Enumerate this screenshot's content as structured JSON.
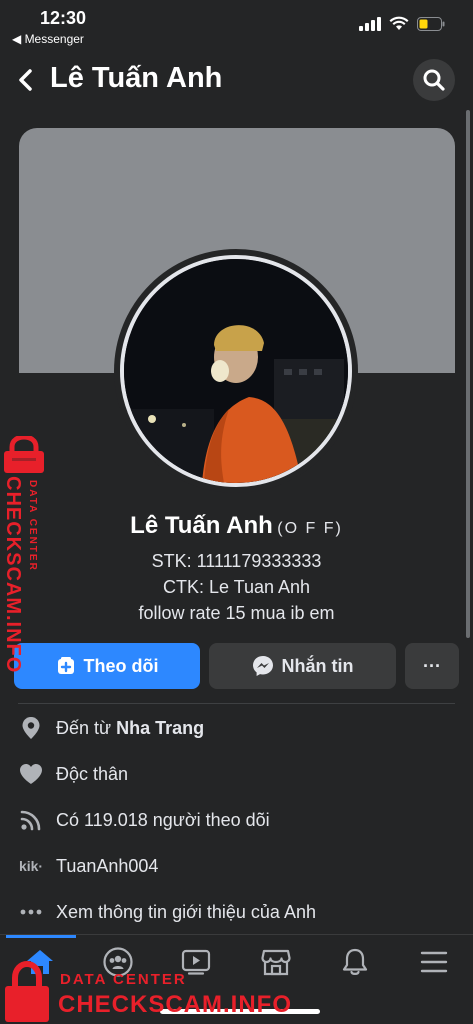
{
  "status_bar": {
    "time": "12:30",
    "back_app": "◀ Messenger"
  },
  "header": {
    "title": "Lê Tuấn Anh"
  },
  "profile": {
    "name": "Lê Tuấn Anh",
    "status": "(O F F)",
    "bio": [
      "STK: 1111179333333",
      "CTK: Le Tuan Anh",
      "follow rate 15 mua ib em"
    ]
  },
  "actions": {
    "follow_label": "Theo dõi",
    "message_label": "Nhắn tin",
    "more_label": "···"
  },
  "info": {
    "location_prefix": "Đến từ",
    "location_city": "Nha Trang",
    "relationship": "Độc thân",
    "followers": "Có 119.018 người theo dõi",
    "kik_label": "kik·",
    "kik_username": "TuanAnh004",
    "see_more": "Xem thông tin giới thiệu của Anh"
  },
  "watermark": {
    "small": "DATA CENTER",
    "big": "CHECKSCAM.INFO"
  },
  "colors": {
    "background": "#242526",
    "accent": "#2d88ff",
    "watermark": "#e8202a"
  },
  "icons": {
    "tab_bar": [
      "home-icon",
      "groups-icon",
      "watch-icon",
      "marketplace-icon",
      "notifications-icon",
      "menu-icon"
    ]
  }
}
